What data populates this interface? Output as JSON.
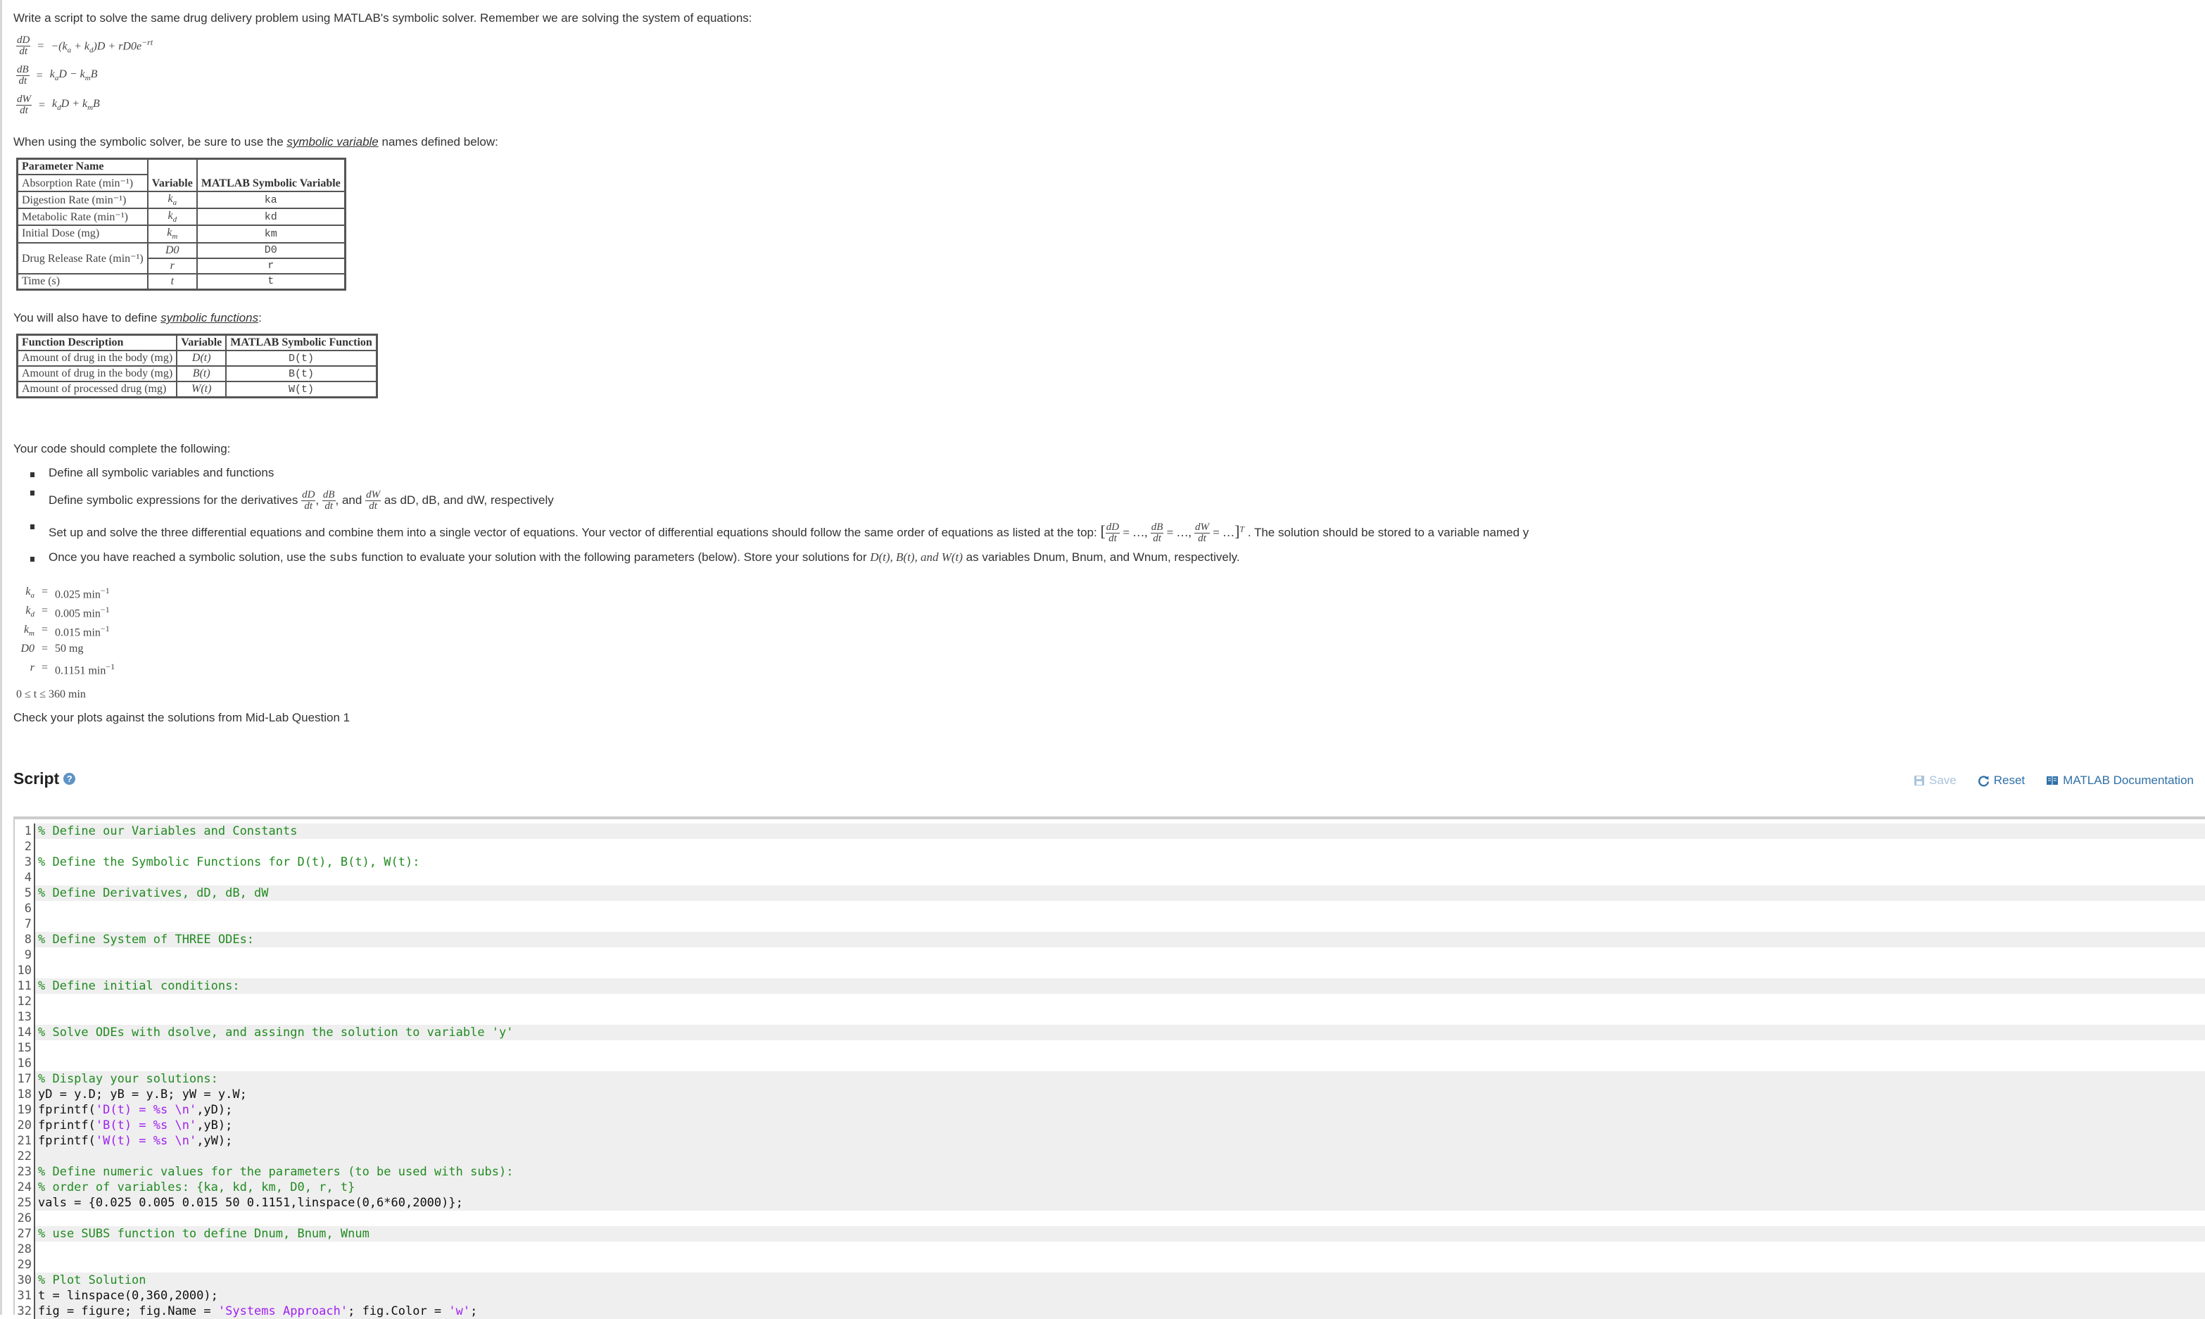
{
  "intro": "Write a script to solve the same drug delivery problem using MATLAB's symbolic solver. Remember we are solving the system of equations:",
  "equations": [
    {
      "lhs_num": "dD",
      "lhs_den": "dt",
      "rhs": "−(ka + kd)D + rD0e−rt"
    },
    {
      "lhs_num": "dB",
      "lhs_den": "dt",
      "rhs": "kaD − kmB"
    },
    {
      "lhs_num": "dW",
      "lhs_den": "dt",
      "rhs": "kdD + kmB"
    }
  ],
  "symvar_intro_before": "When using the symbolic solver, be sure to use the ",
  "symvar_link": "symbolic variable",
  "symvar_intro_after": " names defined below:",
  "param_table": {
    "headers": [
      "Parameter Name",
      "Variable",
      "MATLAB Symbolic Variable"
    ],
    "rows": [
      {
        "name": "Absorption Rate (min⁻¹)",
        "var": "ka",
        "matlab": "ka"
      },
      {
        "name": "Digestion Rate (min⁻¹)",
        "var": "kd",
        "matlab": "kd"
      },
      {
        "name": "Metabolic Rate (min⁻¹)",
        "var": "km",
        "matlab": "km"
      },
      {
        "name": "Initial Dose (mg)",
        "var": "D0",
        "matlab": "D0"
      },
      {
        "name": "Drug Release Rate (min⁻¹)",
        "var": "r",
        "matlab": "r"
      },
      {
        "name": "Time (s)",
        "var": "t",
        "matlab": "t"
      }
    ]
  },
  "symfun_intro_before": "You will also have to define ",
  "symfun_link": "symbolic functions",
  "symfun_intro_after": ":",
  "func_table": {
    "headers": [
      "Function Description",
      "Variable",
      "MATLAB Symbolic Function"
    ],
    "rows": [
      {
        "name": "Amount of drug in the body (mg)",
        "var": "D(t)",
        "matlab": "D(t)"
      },
      {
        "name": "Amount of drug in the body (mg)",
        "var": "B(t)",
        "matlab": "B(t)"
      },
      {
        "name": "Amount of processed drug (mg)",
        "var": "W(t)",
        "matlab": "W(t)"
      }
    ]
  },
  "tasks_intro": "Your code should complete the following:",
  "tasks": {
    "t1": "Define all symbolic variables and functions",
    "t2_before": "Define symbolic expressions for the derivatives",
    "t2_after": "as dD, dB, and dW, respectively",
    "t2_and": ", and",
    "t3_before": "Set up and solve the three differential equations and combine them into a single vector of equations. Your vector  of  differential equations should follow the same order of equations as listed at the top:",
    "t3_after": ". The solution should be stored to a variable named y",
    "t4_before": "Once you have reached a symbolic solution, use the ",
    "t4_code": "subs",
    "t4_mid": " function to evaluate your solution with the following parameters (below). Store your solutions for ",
    "t4_funcs": "D(t), B(t), and W(t)",
    "t4_after": " as variables Dnum, Bnum, and Wnum, respectively."
  },
  "parameters": [
    {
      "sym": "ka",
      "value": "0.025 min",
      "exp": "−1"
    },
    {
      "sym": "kd",
      "value": "0.005 min",
      "exp": "−1"
    },
    {
      "sym": "km",
      "value": "0.015 min",
      "exp": "−1"
    },
    {
      "sym": "D0",
      "value": "50 mg",
      "exp": ""
    },
    {
      "sym": "r",
      "value": "0.1151 min",
      "exp": "−1"
    }
  ],
  "time_range": "0 ≤ t ≤ 360 min",
  "check_note": "Check your plots against the solutions from Mid-Lab Question 1",
  "script": {
    "title": "Script",
    "help_icon": "?",
    "save": "Save",
    "reset": "Reset",
    "docs": "MATLAB Documentation"
  },
  "code_lines": [
    {
      "n": "1",
      "ro": true,
      "parts": [
        [
          "cm",
          "% Define our Variables and Constants"
        ]
      ]
    },
    {
      "n": "2",
      "ro": false,
      "parts": []
    },
    {
      "n": "3",
      "ro": false,
      "parts": [
        [
          "cm",
          "% Define the Symbolic Functions for D(t), B(t), W(t):"
        ]
      ]
    },
    {
      "n": "4",
      "ro": false,
      "parts": []
    },
    {
      "n": "5",
      "ro": true,
      "parts": [
        [
          "cm",
          "% Define Derivatives, dD, dB, dW"
        ]
      ]
    },
    {
      "n": "6",
      "ro": false,
      "parts": []
    },
    {
      "n": "7",
      "ro": false,
      "parts": []
    },
    {
      "n": "8",
      "ro": true,
      "parts": [
        [
          "cm",
          "% Define System of THREE ODEs:"
        ]
      ]
    },
    {
      "n": "9",
      "ro": false,
      "parts": []
    },
    {
      "n": "10",
      "ro": false,
      "parts": []
    },
    {
      "n": "11",
      "ro": true,
      "parts": [
        [
          "cm",
          "% Define initial conditions:"
        ]
      ]
    },
    {
      "n": "12",
      "ro": false,
      "parts": []
    },
    {
      "n": "13",
      "ro": false,
      "parts": []
    },
    {
      "n": "14",
      "ro": true,
      "parts": [
        [
          "cm",
          "% Solve ODEs with dsolve, and assingn the solution to variable 'y'"
        ]
      ]
    },
    {
      "n": "15",
      "ro": false,
      "parts": []
    },
    {
      "n": "16",
      "ro": false,
      "parts": []
    },
    {
      "n": "17",
      "ro": true,
      "parts": [
        [
          "cm",
          "% Display your solutions:"
        ]
      ]
    },
    {
      "n": "18",
      "ro": true,
      "parts": [
        [
          "",
          "yD = y.D; yB = y.B; yW = y.W;"
        ]
      ]
    },
    {
      "n": "19",
      "ro": true,
      "parts": [
        [
          "",
          "fprintf("
        ],
        [
          "st",
          "'D(t) = %s \\n'"
        ],
        [
          "",
          ",yD);"
        ]
      ]
    },
    {
      "n": "20",
      "ro": true,
      "parts": [
        [
          "",
          "fprintf("
        ],
        [
          "st",
          "'B(t) = %s \\n'"
        ],
        [
          "",
          ",yB);"
        ]
      ]
    },
    {
      "n": "21",
      "ro": true,
      "parts": [
        [
          "",
          "fprintf("
        ],
        [
          "st",
          "'W(t) = %s \\n'"
        ],
        [
          "",
          ",yW);"
        ]
      ]
    },
    {
      "n": "22",
      "ro": true,
      "parts": []
    },
    {
      "n": "23",
      "ro": true,
      "parts": [
        [
          "cm",
          "% Define numeric values for the parameters (to be used with subs):"
        ]
      ]
    },
    {
      "n": "24",
      "ro": true,
      "parts": [
        [
          "cm",
          "% order of variables: {ka, kd, km, D0, r, t}"
        ]
      ]
    },
    {
      "n": "25",
      "ro": true,
      "parts": [
        [
          "",
          "vals = {0.025 0.005 0.015 50 0.1151,linspace(0,6*60,2000)};"
        ]
      ]
    },
    {
      "n": "26",
      "ro": false,
      "parts": []
    },
    {
      "n": "27",
      "ro": true,
      "parts": [
        [
          "cm",
          "% use SUBS function to define Dnum, Bnum, Wnum"
        ]
      ]
    },
    {
      "n": "28",
      "ro": false,
      "parts": []
    },
    {
      "n": "29",
      "ro": false,
      "parts": []
    },
    {
      "n": "30",
      "ro": true,
      "parts": [
        [
          "cm",
          "% Plot Solution"
        ]
      ]
    },
    {
      "n": "31",
      "ro": true,
      "parts": [
        [
          "",
          "t = linspace(0,360,2000);"
        ]
      ]
    },
    {
      "n": "32",
      "ro": true,
      "parts": [
        [
          "",
          "fig = figure; fig.Name = "
        ],
        [
          "st",
          "'Systems Approach'"
        ],
        [
          "",
          "; fig.Color = "
        ],
        [
          "st",
          "'w'"
        ],
        [
          "",
          ";"
        ]
      ]
    }
  ]
}
